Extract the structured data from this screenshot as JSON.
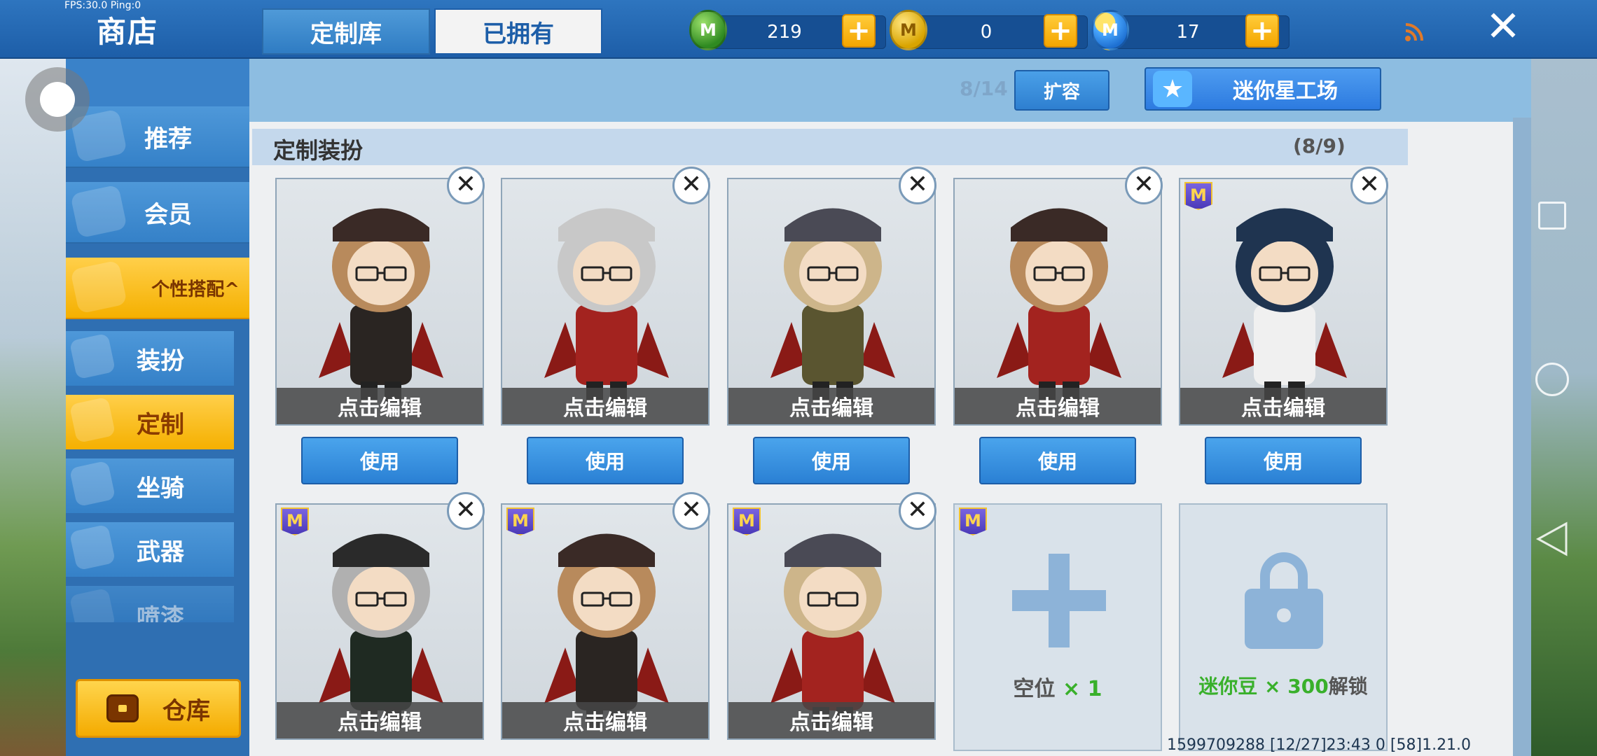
{
  "debug": {
    "fps_text": "FPS:30.0  Ping:0"
  },
  "header": {
    "title": "商店"
  },
  "currencies": [
    {
      "icon": "green-gem-icon",
      "value": "219",
      "glyph": "M"
    },
    {
      "icon": "gold-coin-icon",
      "value": "0",
      "glyph": "M"
    },
    {
      "icon": "mini-bean-icon",
      "value": "17",
      "glyph": "M"
    }
  ],
  "sidebar": {
    "items": [
      {
        "label": "推荐"
      },
      {
        "label": "会员"
      },
      {
        "label": "个性搭配^"
      }
    ],
    "sub_items": [
      {
        "label": "装扮"
      },
      {
        "label": "定制"
      },
      {
        "label": "坐骑"
      },
      {
        "label": "武器"
      },
      {
        "label": "喷漆"
      }
    ],
    "warehouse_label": "仓库"
  },
  "tabs": [
    {
      "label": "定制库"
    },
    {
      "label": "已拥有"
    }
  ],
  "capacity": {
    "text": "8/14",
    "expand_label": "扩容"
  },
  "workshop": {
    "label": "迷你星工场"
  },
  "section": {
    "title": "定制装扮",
    "count": "(8/9)"
  },
  "outfits": [
    {
      "edit_label": "点击编辑",
      "use_label": "使用",
      "hat": "#3a2a26",
      "hair": "#b88a5c",
      "coat": "#2a2522",
      "badge": false
    },
    {
      "edit_label": "点击编辑",
      "use_label": "使用",
      "hat": "#c8c8c8",
      "hair": "#c8c8c8",
      "coat": "#a3231f",
      "badge": false
    },
    {
      "edit_label": "点击编辑",
      "use_label": "使用",
      "hat": "#4a4a55",
      "hair": "#cdb58a",
      "coat": "#5a5530",
      "badge": false
    },
    {
      "edit_label": "点击编辑",
      "use_label": "使用",
      "hat": "#3a2a26",
      "hair": "#b88a5c",
      "coat": "#a3231f",
      "badge": false
    },
    {
      "edit_label": "点击编辑",
      "use_label": "使用",
      "hat": "#1f3450",
      "hair": "#1f3450",
      "coat": "#f0f0f0",
      "badge": true
    },
    {
      "edit_label": "点击编辑",
      "hat": "#2a2a2a",
      "hair": "#b0b0b0",
      "coat": "#1f2a22",
      "badge": true
    },
    {
      "edit_label": "点击编辑",
      "hat": "#3a2a26",
      "hair": "#b88a5c",
      "coat": "#2a2522",
      "badge": true
    },
    {
      "edit_label": "点击编辑",
      "hat": "#4a4a55",
      "hair": "#cdb58a",
      "coat": "#a3231f",
      "badge": true
    }
  ],
  "empty_slot": {
    "label": "空位",
    "count": " × 1"
  },
  "locked_slot": {
    "label": "迷你豆 × 300",
    "suffix": "解锁"
  },
  "footer": {
    "info": "1599709288  [12/27]23:43 0  [58]1.21.0"
  },
  "colors": {
    "accent_blue": "#2f7cc3",
    "active_yellow": "#f5b000",
    "header_blue": "#1d5ea8"
  }
}
